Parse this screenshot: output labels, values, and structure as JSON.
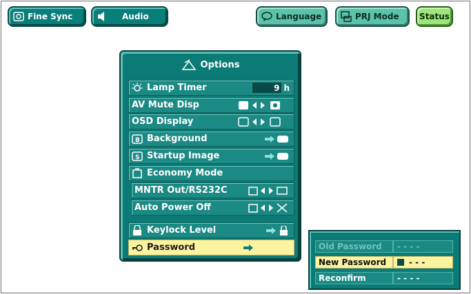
{
  "toolbar": {
    "fine_sync": "Fine Sync",
    "audio": "Audio",
    "language": "Language",
    "prj_mode": "PRJ Mode",
    "status": "Status"
  },
  "options": {
    "title": "Options",
    "lamp_timer": {
      "label": "Lamp Timer",
      "value": "9",
      "unit": "h"
    },
    "av_mute": "AV Mute Disp",
    "osd_display": "OSD Display",
    "background": "Background",
    "startup_image": "Startup Image",
    "economy_mode": "Economy Mode",
    "mntr_out": "MNTR Out/RS232C",
    "auto_power_off": "Auto Power Off",
    "keylock_level": "Keylock Level",
    "password": "Password"
  },
  "password_popup": {
    "old": {
      "label": "Old Password",
      "value": "- - - -"
    },
    "new": {
      "label": "New Password",
      "value": "- - -"
    },
    "reconfirm": {
      "label": "Reconfirm",
      "value": "- - - -"
    }
  },
  "colors": {
    "accent": "#0d7b75",
    "highlight": "#fbf3a0"
  }
}
